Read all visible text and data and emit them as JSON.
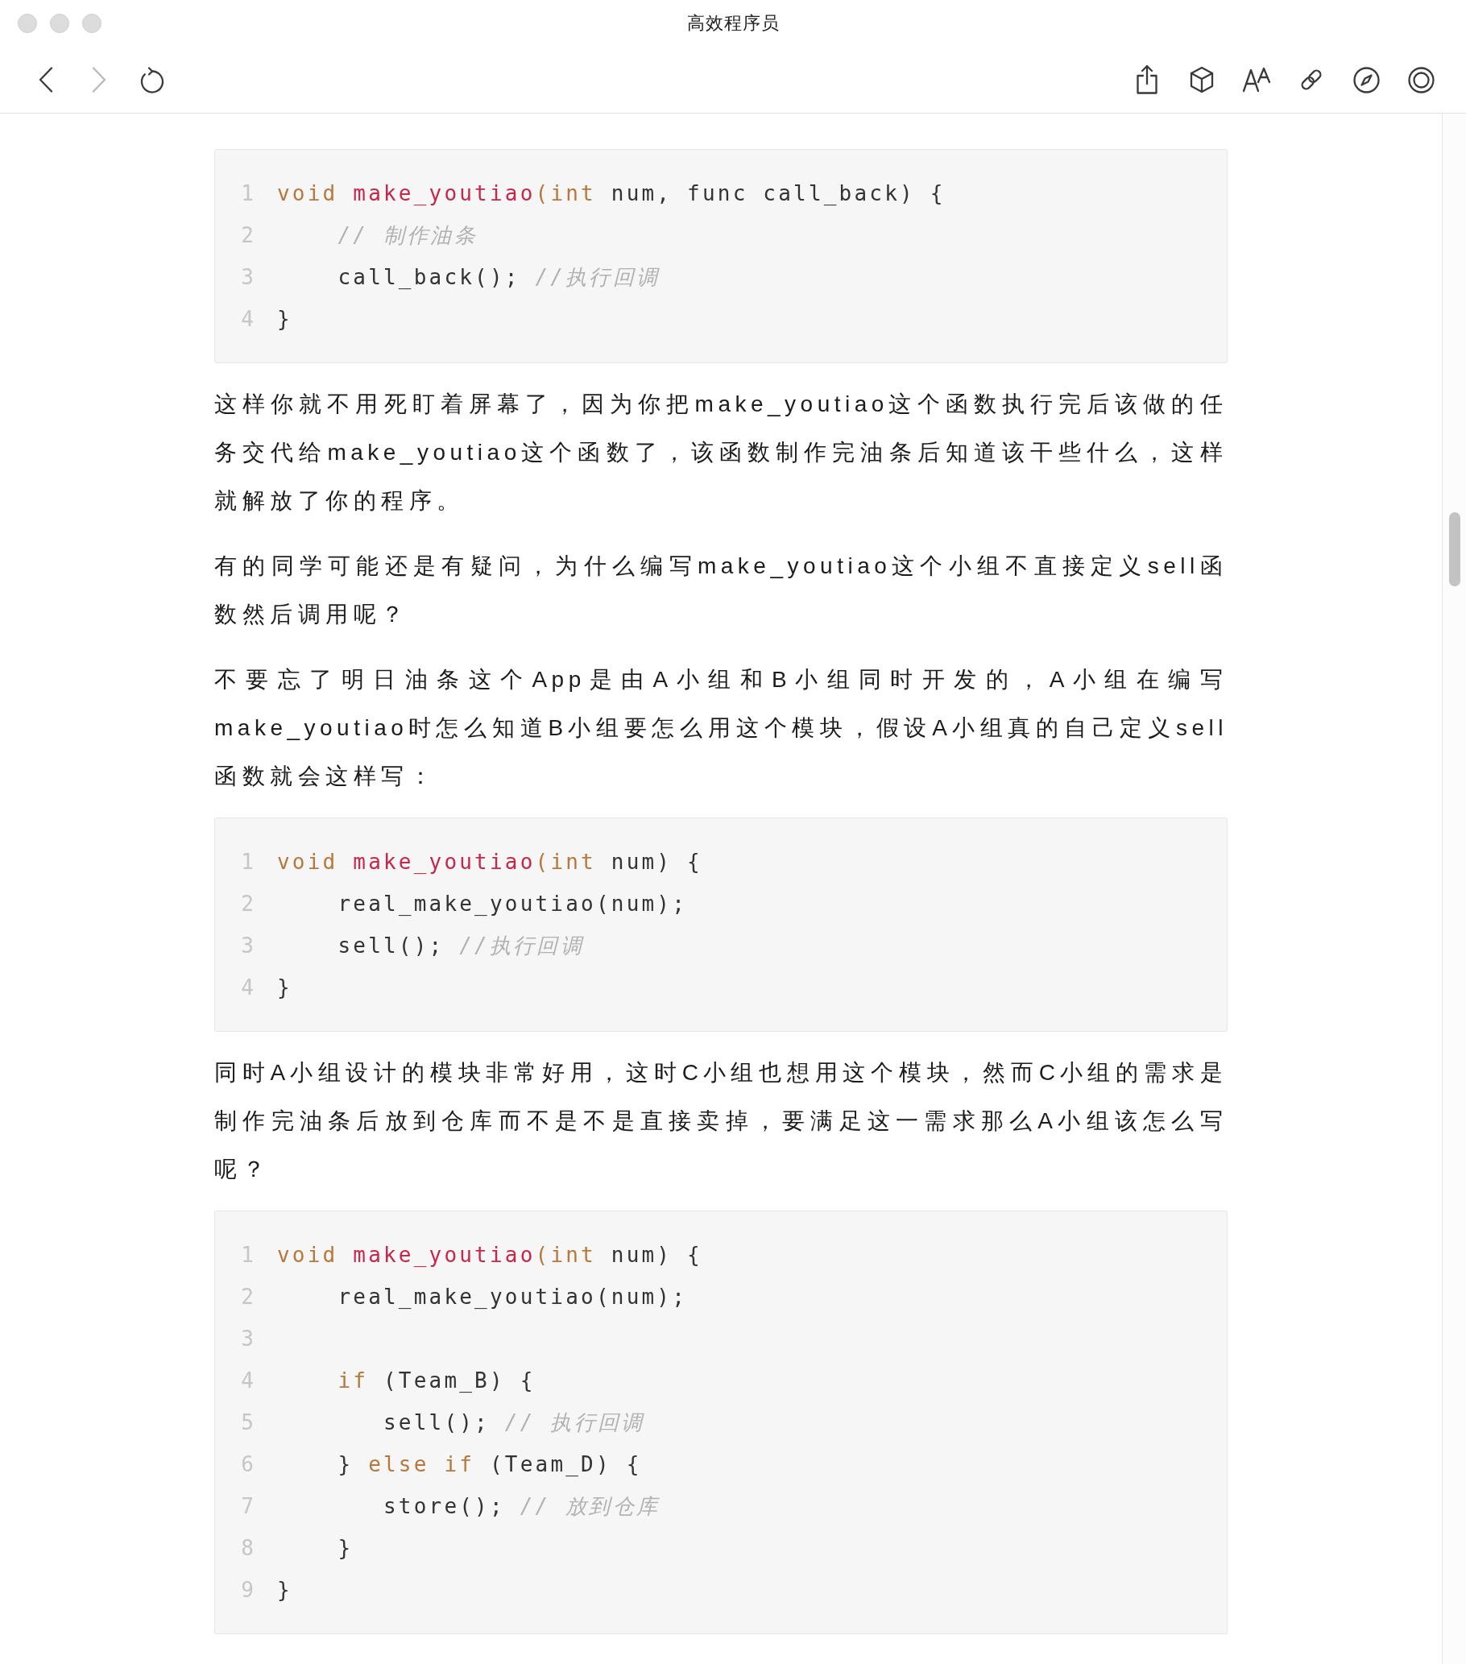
{
  "window": {
    "title": "高效程序员"
  },
  "toolbar": {
    "back": {
      "disabled": false
    },
    "forward": {
      "disabled": true
    }
  },
  "article": {
    "blocks": [
      {
        "kind": "code",
        "lines": [
          {
            "number": "1",
            "tokens": [
              {
                "kind": "keyword",
                "text": "void "
              },
              {
                "kind": "function",
                "text": "make_youtiao"
              },
              {
                "kind": "keyword",
                "text": "(int"
              },
              {
                "kind": "plain",
                "text": " num, func call_back) {"
              }
            ]
          },
          {
            "number": "2",
            "tokens": [
              {
                "kind": "comment",
                "text": "    // 制作油条"
              }
            ]
          },
          {
            "number": "3",
            "tokens": [
              {
                "kind": "plain",
                "text": "    call_back(); "
              },
              {
                "kind": "comment",
                "text": "//执行回调"
              }
            ]
          },
          {
            "number": "4",
            "tokens": [
              {
                "kind": "plain",
                "text": "}"
              }
            ]
          }
        ]
      },
      {
        "kind": "paragraph",
        "text": "这样你就不用死盯着屏幕了，因为你把make_youtiao这个函数执行完后该做的任务交代给make_youtiao这个函数了，该函数制作完油条后知道该干些什么，这样就解放了你的程序。"
      },
      {
        "kind": "paragraph",
        "text": "有的同学可能还是有疑问，为什么编写make_youtiao这个小组不直接定义sell函数然后调用呢？"
      },
      {
        "kind": "paragraph",
        "text": "不要忘了明日油条这个App是由A小组和B小组同时开发的，A小组在编写make_youtiao时怎么知道B小组要怎么用这个模块，假设A小组真的自己定义sell函数就会这样写："
      },
      {
        "kind": "code",
        "lines": [
          {
            "number": "1",
            "tokens": [
              {
                "kind": "keyword",
                "text": "void "
              },
              {
                "kind": "function",
                "text": "make_youtiao"
              },
              {
                "kind": "keyword",
                "text": "(int"
              },
              {
                "kind": "plain",
                "text": " num) {"
              }
            ]
          },
          {
            "number": "2",
            "tokens": [
              {
                "kind": "plain",
                "text": "    real_make_youtiao(num);"
              }
            ]
          },
          {
            "number": "3",
            "tokens": [
              {
                "kind": "plain",
                "text": "    sell(); "
              },
              {
                "kind": "comment",
                "text": "//执行回调"
              }
            ]
          },
          {
            "number": "4",
            "tokens": [
              {
                "kind": "plain",
                "text": "}"
              }
            ]
          }
        ]
      },
      {
        "kind": "paragraph",
        "text": "同时A小组设计的模块非常好用，这时C小组也想用这个模块，然而C小组的需求是制作完油条后放到仓库而不是不是直接卖掉，要满足这一需求那么A小组该怎么写呢？"
      },
      {
        "kind": "code",
        "lines": [
          {
            "number": "1",
            "tokens": [
              {
                "kind": "keyword",
                "text": "void "
              },
              {
                "kind": "function",
                "text": "make_youtiao"
              },
              {
                "kind": "keyword",
                "text": "(int"
              },
              {
                "kind": "plain",
                "text": " num) {"
              }
            ]
          },
          {
            "number": "2",
            "tokens": [
              {
                "kind": "plain",
                "text": "    real_make_youtiao(num);"
              }
            ]
          },
          {
            "number": "3"
          },
          {
            "number": "4",
            "tokens": [
              {
                "kind": "keyword",
                "text": "    if"
              },
              {
                "kind": "plain",
                "text": " (Team_B) {"
              }
            ]
          },
          {
            "number": "5",
            "tokens": [
              {
                "kind": "plain",
                "text": "       sell(); "
              },
              {
                "kind": "comment",
                "text": "// 执行回调"
              }
            ]
          },
          {
            "number": "6",
            "tokens": [
              {
                "kind": "plain",
                "text": "    } "
              },
              {
                "kind": "keyword",
                "text": "else if"
              },
              {
                "kind": "plain",
                "text": " (Team_D) {"
              }
            ]
          },
          {
            "number": "7",
            "tokens": [
              {
                "kind": "plain",
                "text": "       store(); "
              },
              {
                "kind": "comment",
                "text": "// 放到仓库"
              }
            ]
          },
          {
            "number": "8",
            "tokens": [
              {
                "kind": "plain",
                "text": "    }"
              }
            ]
          },
          {
            "number": "9",
            "tokens": [
              {
                "kind": "plain",
                "text": "}"
              }
            ]
          }
        ]
      }
    ]
  }
}
